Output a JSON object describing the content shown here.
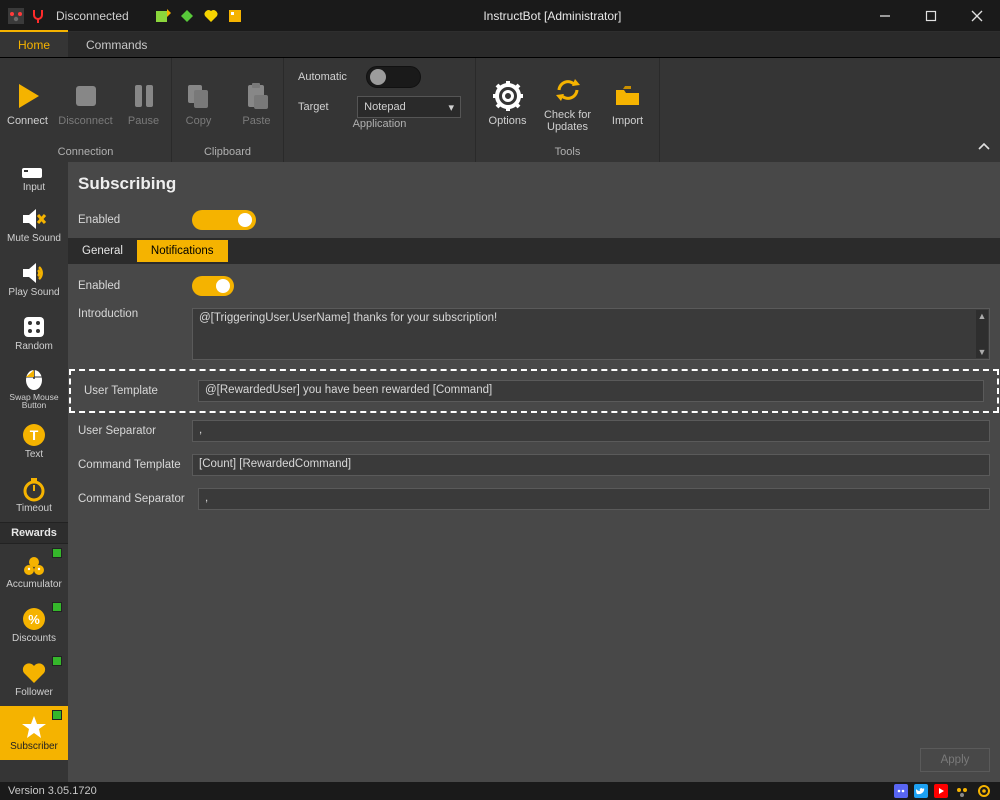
{
  "titlebar": {
    "connection_status": "Disconnected",
    "title": "InstructBot [Administrator]"
  },
  "menutabs": {
    "home": "Home",
    "commands": "Commands"
  },
  "ribbon": {
    "connection": {
      "label": "Connection",
      "connect": "Connect",
      "disconnect": "Disconnect",
      "pause": "Pause"
    },
    "clipboard": {
      "label": "Clipboard",
      "copy": "Copy",
      "paste": "Paste"
    },
    "application": {
      "label": "Application",
      "automatic": "Automatic",
      "automatic_on": false,
      "target_label": "Target",
      "target_value": "Notepad"
    },
    "tools": {
      "label": "Tools",
      "options": "Options",
      "check": "Check for\nUpdates",
      "import": "Import"
    }
  },
  "sidebar": {
    "items": [
      {
        "label": "Input"
      },
      {
        "label": "Mute Sound"
      },
      {
        "label": "Play Sound"
      },
      {
        "label": "Random"
      },
      {
        "label": "Swap Mouse Button"
      },
      {
        "label": "Text"
      },
      {
        "label": "Timeout"
      }
    ],
    "rewards_header": "Rewards",
    "rewards": [
      {
        "label": "Accumulator"
      },
      {
        "label": "Discounts"
      },
      {
        "label": "Follower"
      },
      {
        "label": "Subscriber"
      }
    ]
  },
  "main": {
    "heading": "Subscribing",
    "enabled_label": "Enabled",
    "subtabs": {
      "general": "General",
      "notifications": "Notifications"
    },
    "notif": {
      "enabled_label": "Enabled",
      "intro_label": "Introduction",
      "intro_value": "@[TriggeringUser.UserName] thanks for your subscription!",
      "user_template_label": "User Template",
      "user_template_value": "@[RewardedUser] you have been rewarded [Command]",
      "user_sep_label": "User Separator",
      "user_sep_value": ",",
      "cmd_template_label": "Command Template",
      "cmd_template_value": "[Count] [RewardedCommand]",
      "cmd_sep_label": "Command Separator",
      "cmd_sep_value": ","
    },
    "apply": "Apply"
  },
  "statusbar": {
    "version": "Version 3.05.1720"
  }
}
